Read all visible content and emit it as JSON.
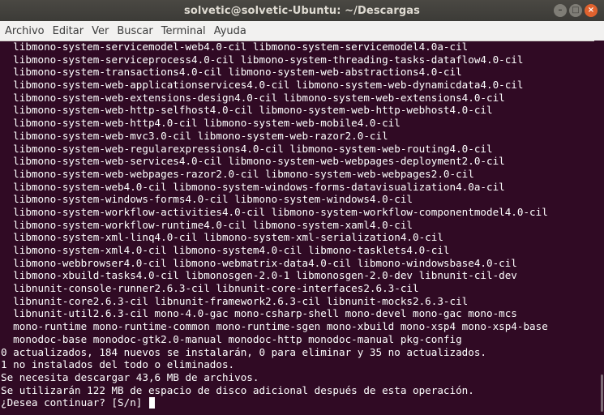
{
  "window": {
    "title": "solvetic@solvetic-Ubuntu: ~/Descargas",
    "buttons": {
      "minimize": "–",
      "maximize": "□",
      "close": "×"
    }
  },
  "menu": [
    "Archivo",
    "Editar",
    "Ver",
    "Buscar",
    "Terminal",
    "Ayuda"
  ],
  "terminal": {
    "lines": [
      "  libmono-system-servicemodel-web4.0-cil libmono-system-servicemodel4.0a-cil",
      "  libmono-system-serviceprocess4.0-cil libmono-system-threading-tasks-dataflow4.0-cil",
      "  libmono-system-transactions4.0-cil libmono-system-web-abstractions4.0-cil",
      "  libmono-system-web-applicationservices4.0-cil libmono-system-web-dynamicdata4.0-cil",
      "  libmono-system-web-extensions-design4.0-cil libmono-system-web-extensions4.0-cil",
      "  libmono-system-web-http-selfhost4.0-cil libmono-system-web-http-webhost4.0-cil",
      "  libmono-system-web-http4.0-cil libmono-system-web-mobile4.0-cil",
      "  libmono-system-web-mvc3.0-cil libmono-system-web-razor2.0-cil",
      "  libmono-system-web-regularexpressions4.0-cil libmono-system-web-routing4.0-cil",
      "  libmono-system-web-services4.0-cil libmono-system-web-webpages-deployment2.0-cil",
      "  libmono-system-web-webpages-razor2.0-cil libmono-system-web-webpages2.0-cil",
      "  libmono-system-web4.0-cil libmono-system-windows-forms-datavisualization4.0a-cil",
      "  libmono-system-windows-forms4.0-cil libmono-system-windows4.0-cil",
      "  libmono-system-workflow-activities4.0-cil libmono-system-workflow-componentmodel4.0-cil",
      "  libmono-system-workflow-runtime4.0-cil libmono-system-xaml4.0-cil",
      "  libmono-system-xml-linq4.0-cil libmono-system-xml-serialization4.0-cil",
      "  libmono-system-xml4.0-cil libmono-system4.0-cil libmono-tasklets4.0-cil",
      "  libmono-webbrowser4.0-cil libmono-webmatrix-data4.0-cil libmono-windowsbase4.0-cil",
      "  libmono-xbuild-tasks4.0-cil libmonosgen-2.0-1 libmonosgen-2.0-dev libnunit-cil-dev",
      "  libnunit-console-runner2.6.3-cil libnunit-core-interfaces2.6.3-cil",
      "  libnunit-core2.6.3-cil libnunit-framework2.6.3-cil libnunit-mocks2.6.3-cil",
      "  libnunit-util2.6.3-cil mono-4.0-gac mono-csharp-shell mono-devel mono-gac mono-mcs",
      "  mono-runtime mono-runtime-common mono-runtime-sgen mono-xbuild mono-xsp4 mono-xsp4-base",
      "  monodoc-base monodoc-gtk2.0-manual monodoc-http monodoc-manual pkg-config",
      "0 actualizados, 184 nuevos se instalarán, 0 para eliminar y 35 no actualizados.",
      "1 no instalados del todo o eliminados.",
      "Se necesita descargar 43,6 MB de archivos.",
      "Se utilizarán 122 MB de espacio de disco adicional después de esta operación.",
      "¿Desea continuar? [S/n] "
    ]
  }
}
